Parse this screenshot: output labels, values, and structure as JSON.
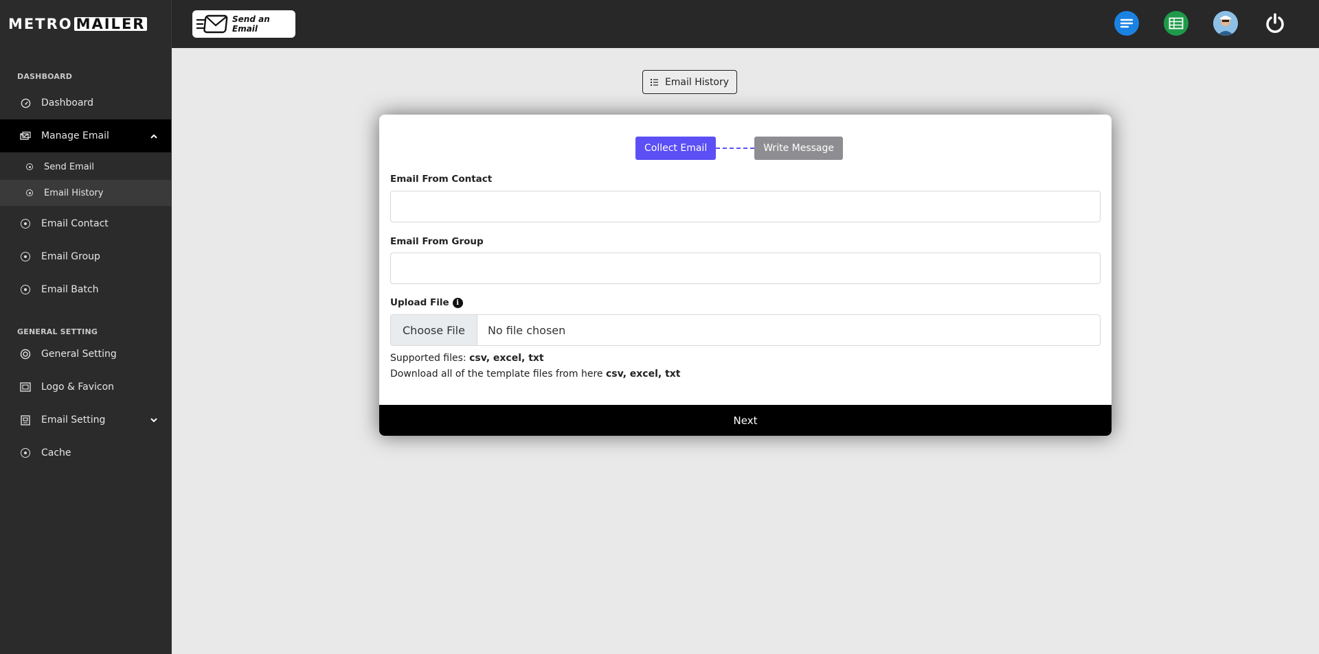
{
  "brand": {
    "part1": "METRO",
    "part2": "MAILER"
  },
  "sidebar": {
    "section_dashboard": "DASHBOARD",
    "dashboard": "Dashboard",
    "manage_email": "Manage Email",
    "send_email": "Send Email",
    "email_history": "Email History",
    "email_contact": "Email Contact",
    "email_group": "Email Group",
    "email_batch": "Email Batch",
    "section_general": "GENERAL SETTING",
    "general_setting": "General Setting",
    "logo_favicon": "Logo & Favicon",
    "email_setting": "Email Setting",
    "cache": "Cache"
  },
  "topbar": {
    "send_badge_label": "Send an Email",
    "icons": [
      "menu-icon",
      "spreadsheet-icon",
      "avatar",
      "power-icon"
    ],
    "colors": {
      "menu": "#1a82e2",
      "spreadsheet": "#1e9a4a"
    }
  },
  "main": {
    "history_button": "Email History",
    "steps": {
      "collect": "Collect Email",
      "write": "Write Message"
    },
    "email_from_contact_label": "Email From Contact",
    "email_from_contact_value": "",
    "email_from_group_label": "Email From Group",
    "email_from_group_value": "",
    "upload_file_label": "Upload File",
    "choose_file": "Choose File",
    "no_file": "No file chosen",
    "supported_prefix": "Supported files:",
    "supported_types": "csv, excel, txt",
    "download_prefix": "Download all of the template files from here",
    "download_types": "csv, excel, txt",
    "next_button": "Next"
  },
  "colors": {
    "accent": "#5b4ff5",
    "step_inactive": "#8e8e92",
    "sidebar_bg": "#2b2b2b",
    "topbar_bg": "#282828"
  }
}
